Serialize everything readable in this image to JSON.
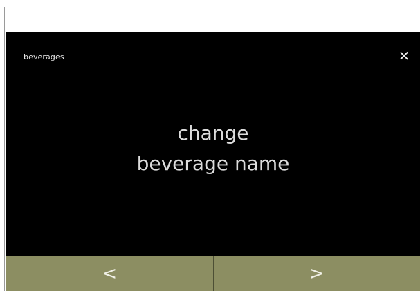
{
  "screen": {
    "title": "beverages",
    "close_icon_glyph": "✕",
    "message_lines": [
      "change",
      "beverage name"
    ]
  },
  "nav": {
    "prev_glyph": "<",
    "next_glyph": ">"
  },
  "colors": {
    "screen_background": "#000000",
    "nav_bar": "#8c8e62",
    "text": "#dcdcdc"
  },
  "icons": {
    "close": "close-icon",
    "previous": "chevron-left-icon",
    "next": "chevron-right-icon"
  }
}
